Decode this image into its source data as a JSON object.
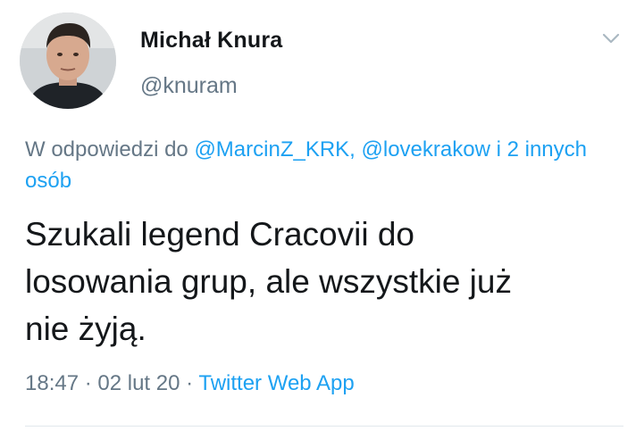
{
  "user": {
    "display_name": "Michał Knura",
    "handle": "@knuram"
  },
  "reply": {
    "prefix": "W odpowiedzi do ",
    "mentions": [
      "@MarcinZ_KRK",
      "@lovekrakow"
    ],
    "separator": ", ",
    "connector": " i ",
    "others": "2 innych osób"
  },
  "tweet": {
    "text": "Szukali legend Cracovii do\nlosowania grup, ale wszystkie już\nnie żyją."
  },
  "meta": {
    "time": "18:47",
    "dot1": " · ",
    "date": "02 lut 20",
    "dot2": " · ",
    "source": "Twitter Web App"
  },
  "icons": {
    "menu": "chevron-down-icon",
    "avatar": "profile-photo"
  },
  "colors": {
    "text": "#14171a",
    "secondary": "#657786",
    "link": "#1da1f2"
  }
}
